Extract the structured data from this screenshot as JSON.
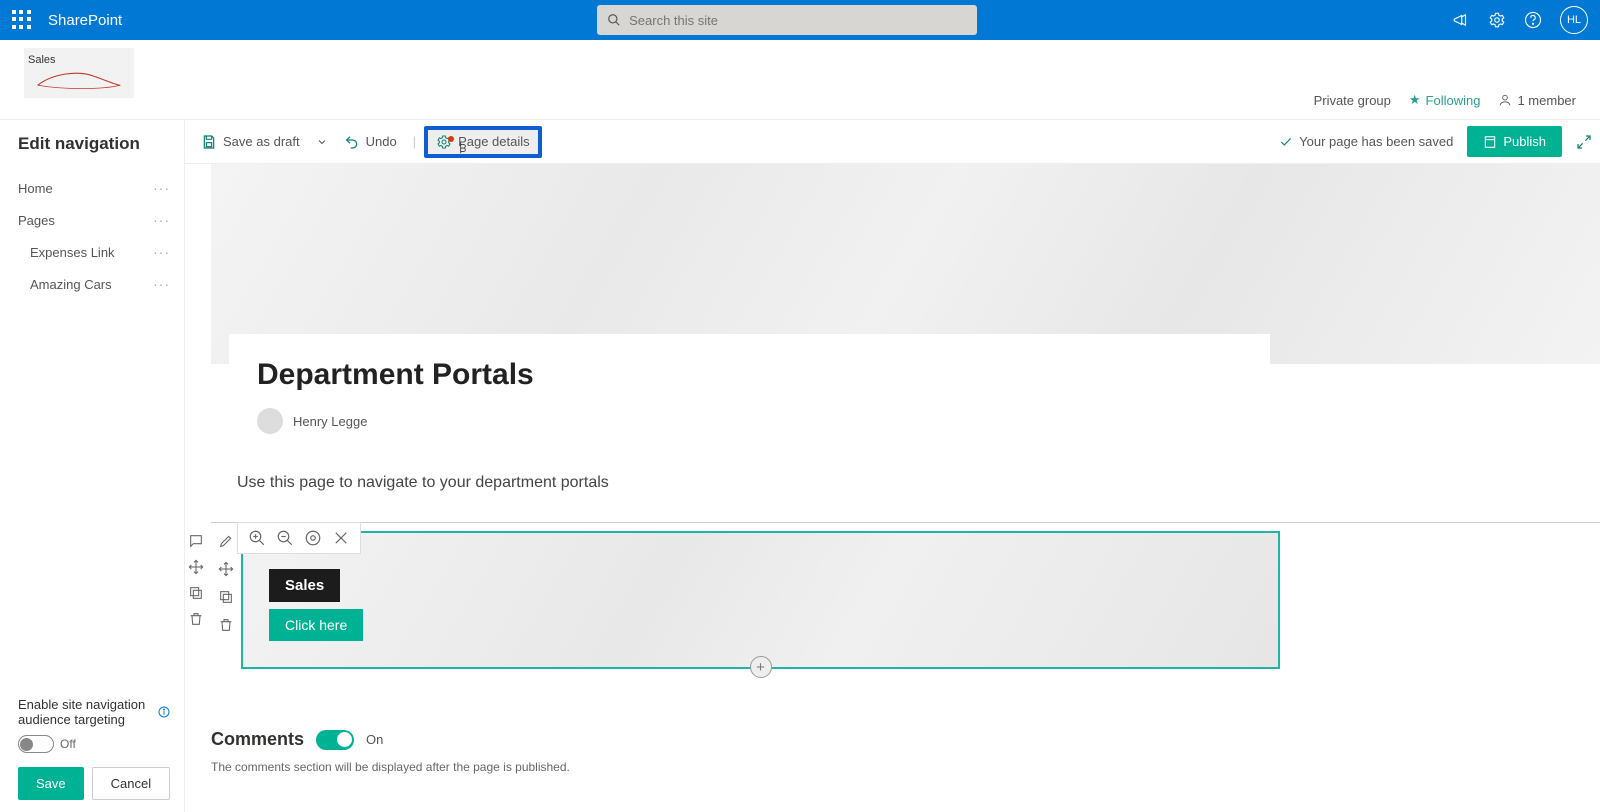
{
  "topbar": {
    "brand": "SharePoint",
    "search_placeholder": "Search this site",
    "avatar_initials": "HL"
  },
  "site": {
    "name": "Sales",
    "group_status": "Private group",
    "following_label": "Following",
    "members_label": "1 member"
  },
  "sidenav": {
    "heading": "Edit navigation",
    "items": {
      "home": "Home",
      "pages": "Pages",
      "expenses": "Expenses Link",
      "amazing": "Amazing Cars"
    },
    "audience_label": "Enable site navigation audience targeting",
    "audience_state": "Off",
    "save": "Save",
    "cancel": "Cancel"
  },
  "toolbar": {
    "save_draft": "Save as draft",
    "undo": "Undo",
    "page_details": "Page details",
    "saved_msg": "Your page has been saved",
    "publish": "Publish"
  },
  "page": {
    "title": "Department Portals",
    "author": "Henry Legge",
    "desc": "Use this page to navigate to your department portals"
  },
  "webpart": {
    "label": "Sales",
    "button": "Click here"
  },
  "comments": {
    "heading": "Comments",
    "state": "On",
    "note": "The comments section will be displayed after the page is published."
  }
}
